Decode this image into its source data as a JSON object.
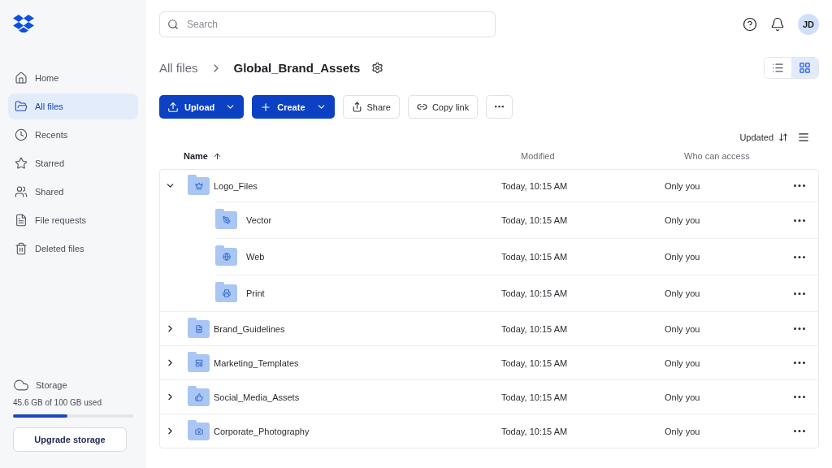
{
  "sidebar": {
    "items": [
      {
        "label": "Home",
        "selected": false
      },
      {
        "label": "All files",
        "selected": true
      },
      {
        "label": "Recents",
        "selected": false
      },
      {
        "label": "Starred",
        "selected": false
      },
      {
        "label": "Shared",
        "selected": false
      },
      {
        "label": "File requests",
        "selected": false
      },
      {
        "label": "Deleted files",
        "selected": false
      }
    ],
    "storage": {
      "title": "Storage",
      "usage": "45.6 GB of 100 GB used",
      "level": 0.456,
      "button": "Upgrade storage"
    }
  },
  "topbar": {
    "search": {
      "placeholder": "Search"
    },
    "avatar": "JD"
  },
  "breadcrumb": {
    "parent": "All files",
    "current": "Global_Brand_Assets"
  },
  "view_modes": [
    {
      "selected": false
    },
    {
      "selected": true
    }
  ],
  "actions": {
    "upload": "Upload",
    "create": "Create",
    "share": "Share",
    "copy_link": "Copy link"
  },
  "sort": {
    "label": "Updated"
  },
  "table": {
    "columns": [
      "Name",
      "Modified",
      "Who can access"
    ],
    "rows": [
      {
        "name": "Logo_Files",
        "modified": "Today, 10:15 AM",
        "access": "Only you",
        "expanded": true,
        "children": [
          {
            "name": "Vector",
            "modified": "Today, 10:15 AM",
            "access": "Only you"
          },
          {
            "name": "Web",
            "modified": "Today, 10:15 AM",
            "access": "Only you"
          },
          {
            "name": "Print",
            "modified": "Today, 10:15 AM",
            "access": "Only you"
          }
        ]
      },
      {
        "name": "Brand_Guidelines",
        "modified": "Today, 10:15 AM",
        "access": "Only you",
        "expanded": false
      },
      {
        "name": "Marketing_Templates",
        "modified": "Today, 10:15 AM",
        "access": "Only you",
        "expanded": false
      },
      {
        "name": "Social_Media_Assets",
        "modified": "Today, 10:15 AM",
        "access": "Only you",
        "expanded": false
      },
      {
        "name": "Corporate_Photography",
        "modified": "Today, 10:15 AM",
        "access": "Only you",
        "expanded": false
      }
    ]
  }
}
